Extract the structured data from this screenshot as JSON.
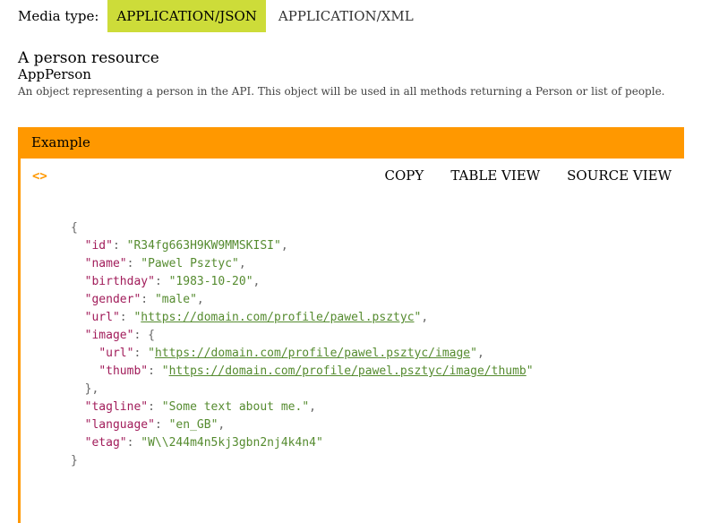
{
  "media": {
    "label": "Media type:",
    "options": [
      "APPLICATION/JSON",
      "APPLICATION/XML"
    ],
    "selected": "APPLICATION/JSON"
  },
  "resource": {
    "title": "A person resource",
    "name": "AppPerson",
    "description": "An object representing a person in the API. This object will be used in all methods returning a Person or list of people."
  },
  "example": {
    "header": "Example",
    "actions": {
      "copy": "COPY",
      "table_view": "TABLE VIEW",
      "source_view": "SOURCE VIEW"
    },
    "code": {
      "id": "R34fg663H9KW9MMSKISI",
      "name": "Pawel Psztyc",
      "birthday": "1983-10-20",
      "gender": "male",
      "url": "https://domain.com/profile/pawel.psztyc",
      "image_url": "https://domain.com/profile/pawel.psztyc/image",
      "image_thumb": "https://domain.com/profile/pawel.psztyc/image/thumb",
      "tagline": "Some text about me.",
      "language": "en_GB",
      "etag": "W\\\\244m4n5kj3gbn2nj4k4n4"
    }
  },
  "colors": {
    "accent_orange": "#ff9800",
    "selected_green": "#cddc39",
    "key": "#a11c5a",
    "string": "#558b2f"
  }
}
